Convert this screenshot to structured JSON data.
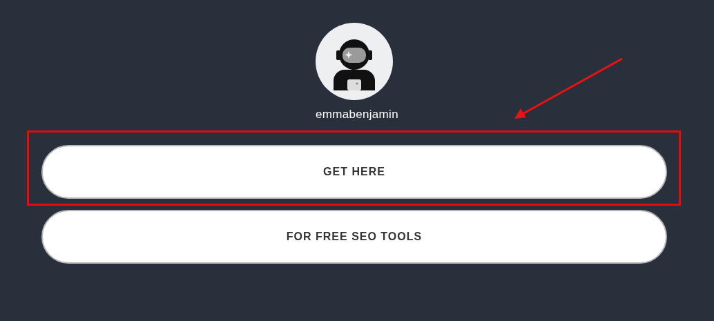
{
  "profile": {
    "username": "emmabenjamin"
  },
  "links": [
    {
      "label": "GET HERE",
      "highlighted": true
    },
    {
      "label": "FOR FREE SEO TOOLS",
      "highlighted": false
    }
  ]
}
